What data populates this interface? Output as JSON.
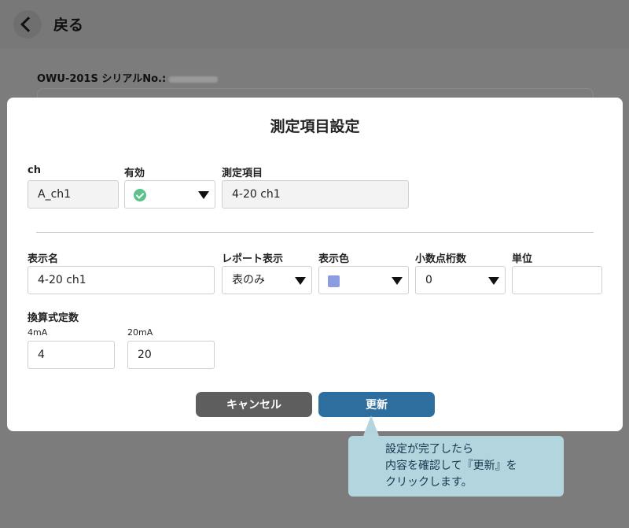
{
  "header": {
    "back_label": "戻る"
  },
  "device": {
    "label": "OWU-201S シリアルNo.:"
  },
  "modal": {
    "title": "測定項目設定",
    "ch": {
      "label": "ch",
      "value": "A_ch1"
    },
    "enabled": {
      "label": "有効"
    },
    "measure_item": {
      "label": "測定項目",
      "value": "4-20 ch1"
    },
    "display_name": {
      "label": "表示名",
      "value": "4-20 ch1"
    },
    "report_display": {
      "label": "レポート表示",
      "value": "表のみ"
    },
    "display_color": {
      "label": "表示色",
      "color": "#8d9be0"
    },
    "decimal_places": {
      "label": "小数点桁数",
      "value": "0"
    },
    "unit": {
      "label": "単位",
      "value": ""
    },
    "conversion": {
      "label": "換算式定数",
      "ma4": {
        "label": "4mA",
        "value": "4"
      },
      "ma20": {
        "label": "20mA",
        "value": "20"
      }
    },
    "buttons": {
      "cancel": "キャンセル",
      "update": "更新"
    }
  },
  "callout": {
    "lines": [
      "設定が完了したら",
      "内容を確認して『更新』を",
      "クリックします。"
    ]
  },
  "colors": {
    "update_button": "#2e6e9e",
    "cancel_button": "#5e5e5e",
    "enabled_check": "#5cc28a",
    "callout_bg": "#b3d6de"
  }
}
